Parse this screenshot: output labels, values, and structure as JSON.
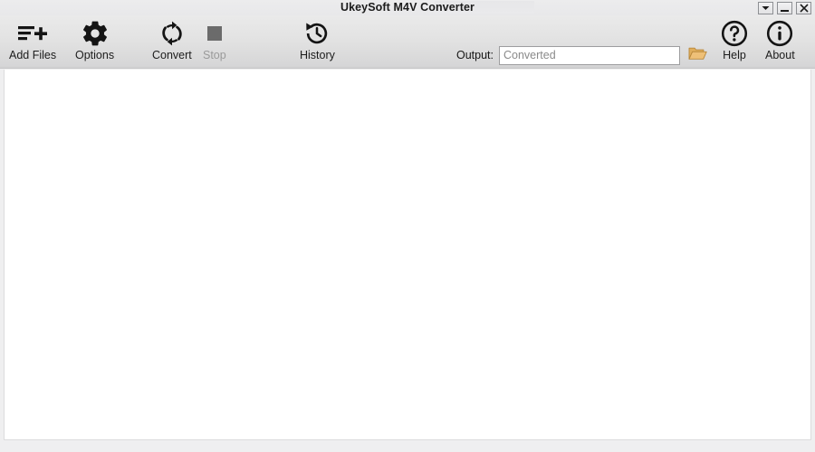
{
  "window": {
    "title": "UkeySoft M4V Converter",
    "controls": [
      {
        "name": "dropdown-button",
        "icon": "chevron-down-icon",
        "label": ""
      },
      {
        "name": "minimize-button",
        "icon": "minimize-icon",
        "label": ""
      },
      {
        "name": "close-button",
        "icon": "close-icon",
        "label": ""
      }
    ]
  },
  "toolbar": {
    "items": [
      {
        "id": "add-files",
        "label": "Add Files",
        "icon": "add-files-icon",
        "enabled": true
      },
      {
        "id": "options",
        "label": "Options",
        "icon": "gear-icon",
        "enabled": true
      },
      {
        "id": "convert",
        "label": "Convert",
        "icon": "refresh-icon",
        "enabled": true
      },
      {
        "id": "stop",
        "label": "Stop",
        "icon": "stop-square-icon",
        "enabled": false
      },
      {
        "id": "history",
        "label": "History",
        "icon": "history-clock-icon",
        "enabled": true
      },
      {
        "id": "help",
        "label": "Help",
        "icon": "question-circle-icon",
        "enabled": true
      },
      {
        "id": "about",
        "label": "About",
        "icon": "info-circle-icon",
        "enabled": true
      }
    ],
    "output": {
      "label": "Output:",
      "value": "",
      "placeholder": "Converted",
      "browse_icon": "folder-open-icon"
    }
  },
  "main": {
    "file_list_items": [],
    "empty": true
  },
  "statusbar": {
    "text": ""
  },
  "colors": {
    "toolbar_top": "#eaeaea",
    "toolbar_bottom": "#cfcfd1",
    "titlebar": "#e8e8ea",
    "content_bg": "#ffffff",
    "text": "#1c1c1c",
    "disabled_text": "#9a9a9a",
    "folder_icon": "#d9a04a"
  }
}
